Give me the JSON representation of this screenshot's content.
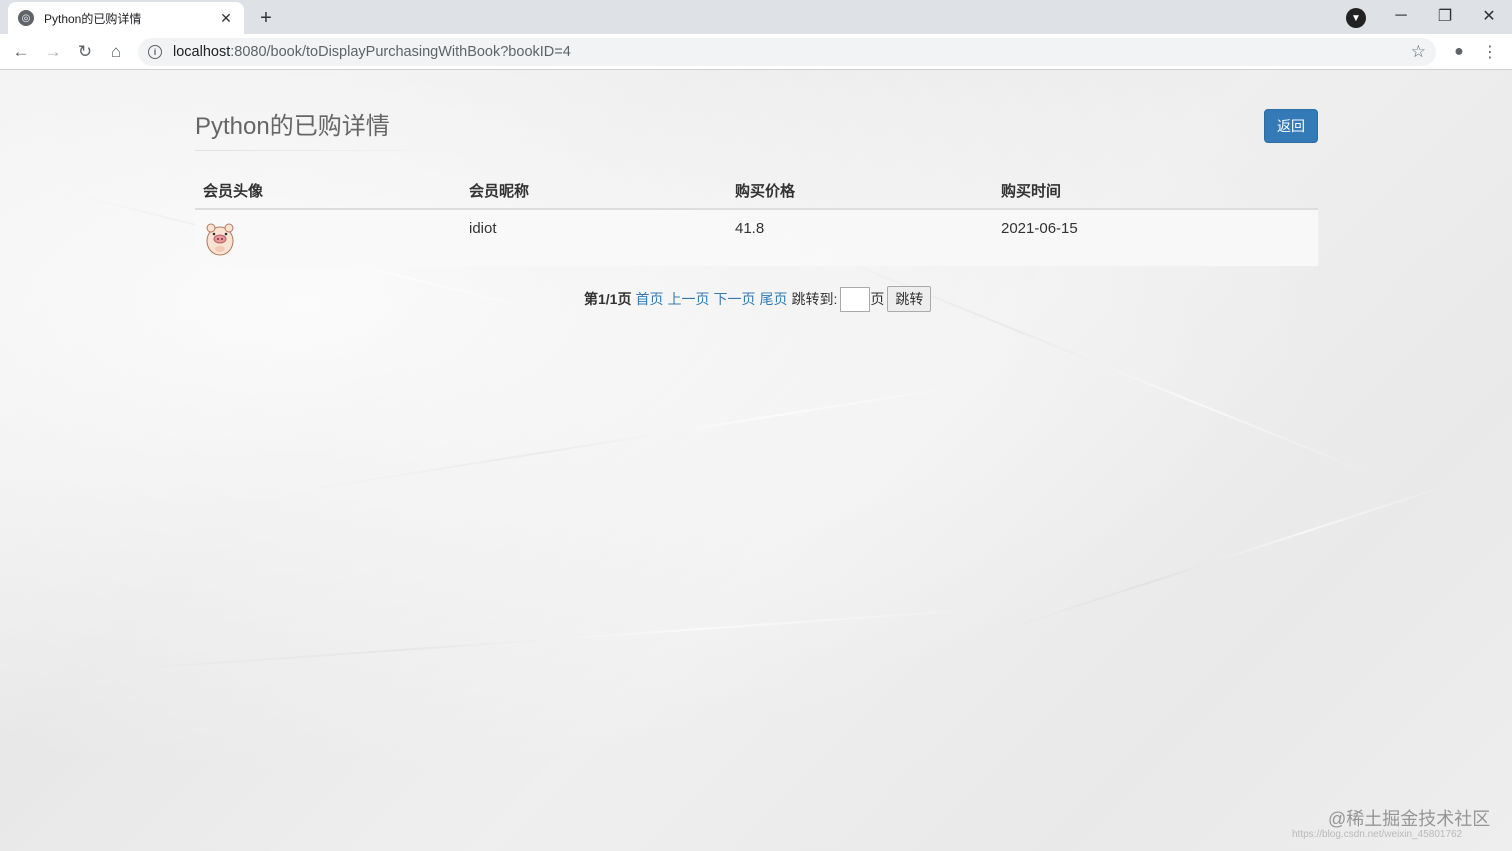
{
  "browser": {
    "tab_title": "Python的已购详情",
    "tab_favicon": "globe-icon",
    "new_tab_label": "+",
    "url_host": "localhost",
    "url_path": ":8080/book/toDisplayPurchasingWithBook?bookID=4"
  },
  "page": {
    "title": "Python的已购详情",
    "back_label": "返回"
  },
  "table": {
    "headers": [
      "会员头像",
      "会员昵称",
      "购买价格",
      "购买时间"
    ],
    "rows": [
      {
        "avatar": "pig-avatar-icon",
        "nickname": "idiot",
        "price": "41.8",
        "date": "2021-06-15"
      }
    ]
  },
  "pager": {
    "page_info": "第1/1页",
    "first": "首页",
    "prev": "上一页",
    "next": "下一页",
    "last": "尾页",
    "jump_to": "跳转到:",
    "page_unit": "页",
    "jump_button": "跳转",
    "input_value": ""
  },
  "watermark": {
    "text": "@稀土掘金技术社区",
    "sub": "https://blog.csdn.net/weixin_45801762"
  },
  "colors": {
    "primary": "#337ab7",
    "chrome_bg": "#dee1e6"
  }
}
